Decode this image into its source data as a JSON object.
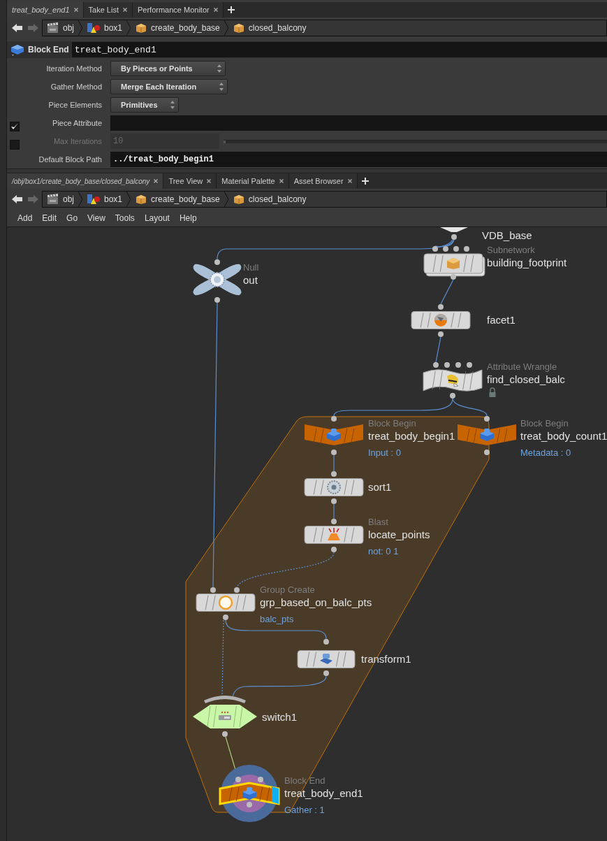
{
  "parameter_pane": {
    "tabs": [
      {
        "label": "treat_body_end1",
        "selected": true
      },
      {
        "label": "Take List",
        "selected": false
      },
      {
        "label": "Performance Monitor",
        "selected": false
      }
    ],
    "path": [
      {
        "label": "obj",
        "kind": "network"
      },
      {
        "label": "box1",
        "kind": "geometry"
      },
      {
        "label": "create_body_base",
        "kind": "subnet"
      },
      {
        "label": "closed_balcony",
        "kind": "subnet"
      }
    ],
    "node_type": "Block End",
    "node_name": "treat_body_end1",
    "rows": [
      {
        "kind": "menu",
        "label": "Iteration Method",
        "value": "By Pieces or Points",
        "disabled": false
      },
      {
        "kind": "menu",
        "label": "Gather Method",
        "value": "Merge Each Iteration",
        "disabled": false
      },
      {
        "kind": "menu",
        "label": "Piece Elements",
        "value": "Primitives",
        "disabled": false
      },
      {
        "kind": "text",
        "label": "Piece Attribute",
        "checked": true,
        "disabled": false
      },
      {
        "kind": "slider",
        "label": "Max Iterations",
        "checked": false,
        "disabled": true,
        "value": "10",
        "level": 0
      },
      {
        "kind": "text",
        "label": "Default Block Path",
        "value": "../treat_body_begin1",
        "disabled": false
      }
    ]
  },
  "network_pane": {
    "tabs": [
      {
        "label": "/obj/box1/create_body_base/closed_balcony",
        "selected": true
      },
      {
        "label": "Tree View",
        "selected": false
      },
      {
        "label": "Material Palette",
        "selected": false
      },
      {
        "label": "Asset Browser",
        "selected": false
      }
    ],
    "path": [
      {
        "label": "obj",
        "kind": "network"
      },
      {
        "label": "box1",
        "kind": "geometry"
      },
      {
        "label": "create_body_base",
        "kind": "subnet"
      },
      {
        "label": "closed_balcony",
        "kind": "subnet"
      }
    ],
    "menu": [
      "Add",
      "Edit",
      "Go",
      "View",
      "Tools",
      "Layout",
      "Help"
    ],
    "nodes": [
      {
        "kind": "clipped",
        "name": "VDB_base",
        "selected": false
      },
      {
        "kind": "subnet",
        "type": "Subnetwork",
        "name": "building_footprint",
        "selected": false
      },
      {
        "kind": "null",
        "type": "Null",
        "name": "out",
        "selected": false
      },
      {
        "kind": "standard",
        "name": "facet1",
        "selected": false
      },
      {
        "kind": "wrangle",
        "type": "Attribute Wrangle",
        "name": "find_closed_balc",
        "selected": false,
        "locked": true
      },
      {
        "kind": "block_begin",
        "type": "Block Begin",
        "name": "treat_body_begin1",
        "info": "Input : 0",
        "selected": false
      },
      {
        "kind": "block_begin",
        "type": "Block Begin",
        "name": "treat_body_count1",
        "info": "Metadata : 0",
        "selected": false
      },
      {
        "kind": "standard",
        "name": "sort1",
        "selected": false
      },
      {
        "kind": "standard",
        "type": "Blast",
        "name": "locate_points",
        "info": "not: 0 1",
        "selected": false
      },
      {
        "kind": "standard",
        "type": "Group Create",
        "name": "grp_based_on_balc_pts",
        "info": "balc_pts",
        "selected": false
      },
      {
        "kind": "standard",
        "name": "transform1",
        "selected": false
      },
      {
        "kind": "switch",
        "name": "switch1",
        "selected": false
      },
      {
        "kind": "block_end",
        "type": "Block End",
        "name": "treat_body_end1",
        "info": "Gather : 1",
        "selected": true,
        "display": true
      }
    ]
  }
}
